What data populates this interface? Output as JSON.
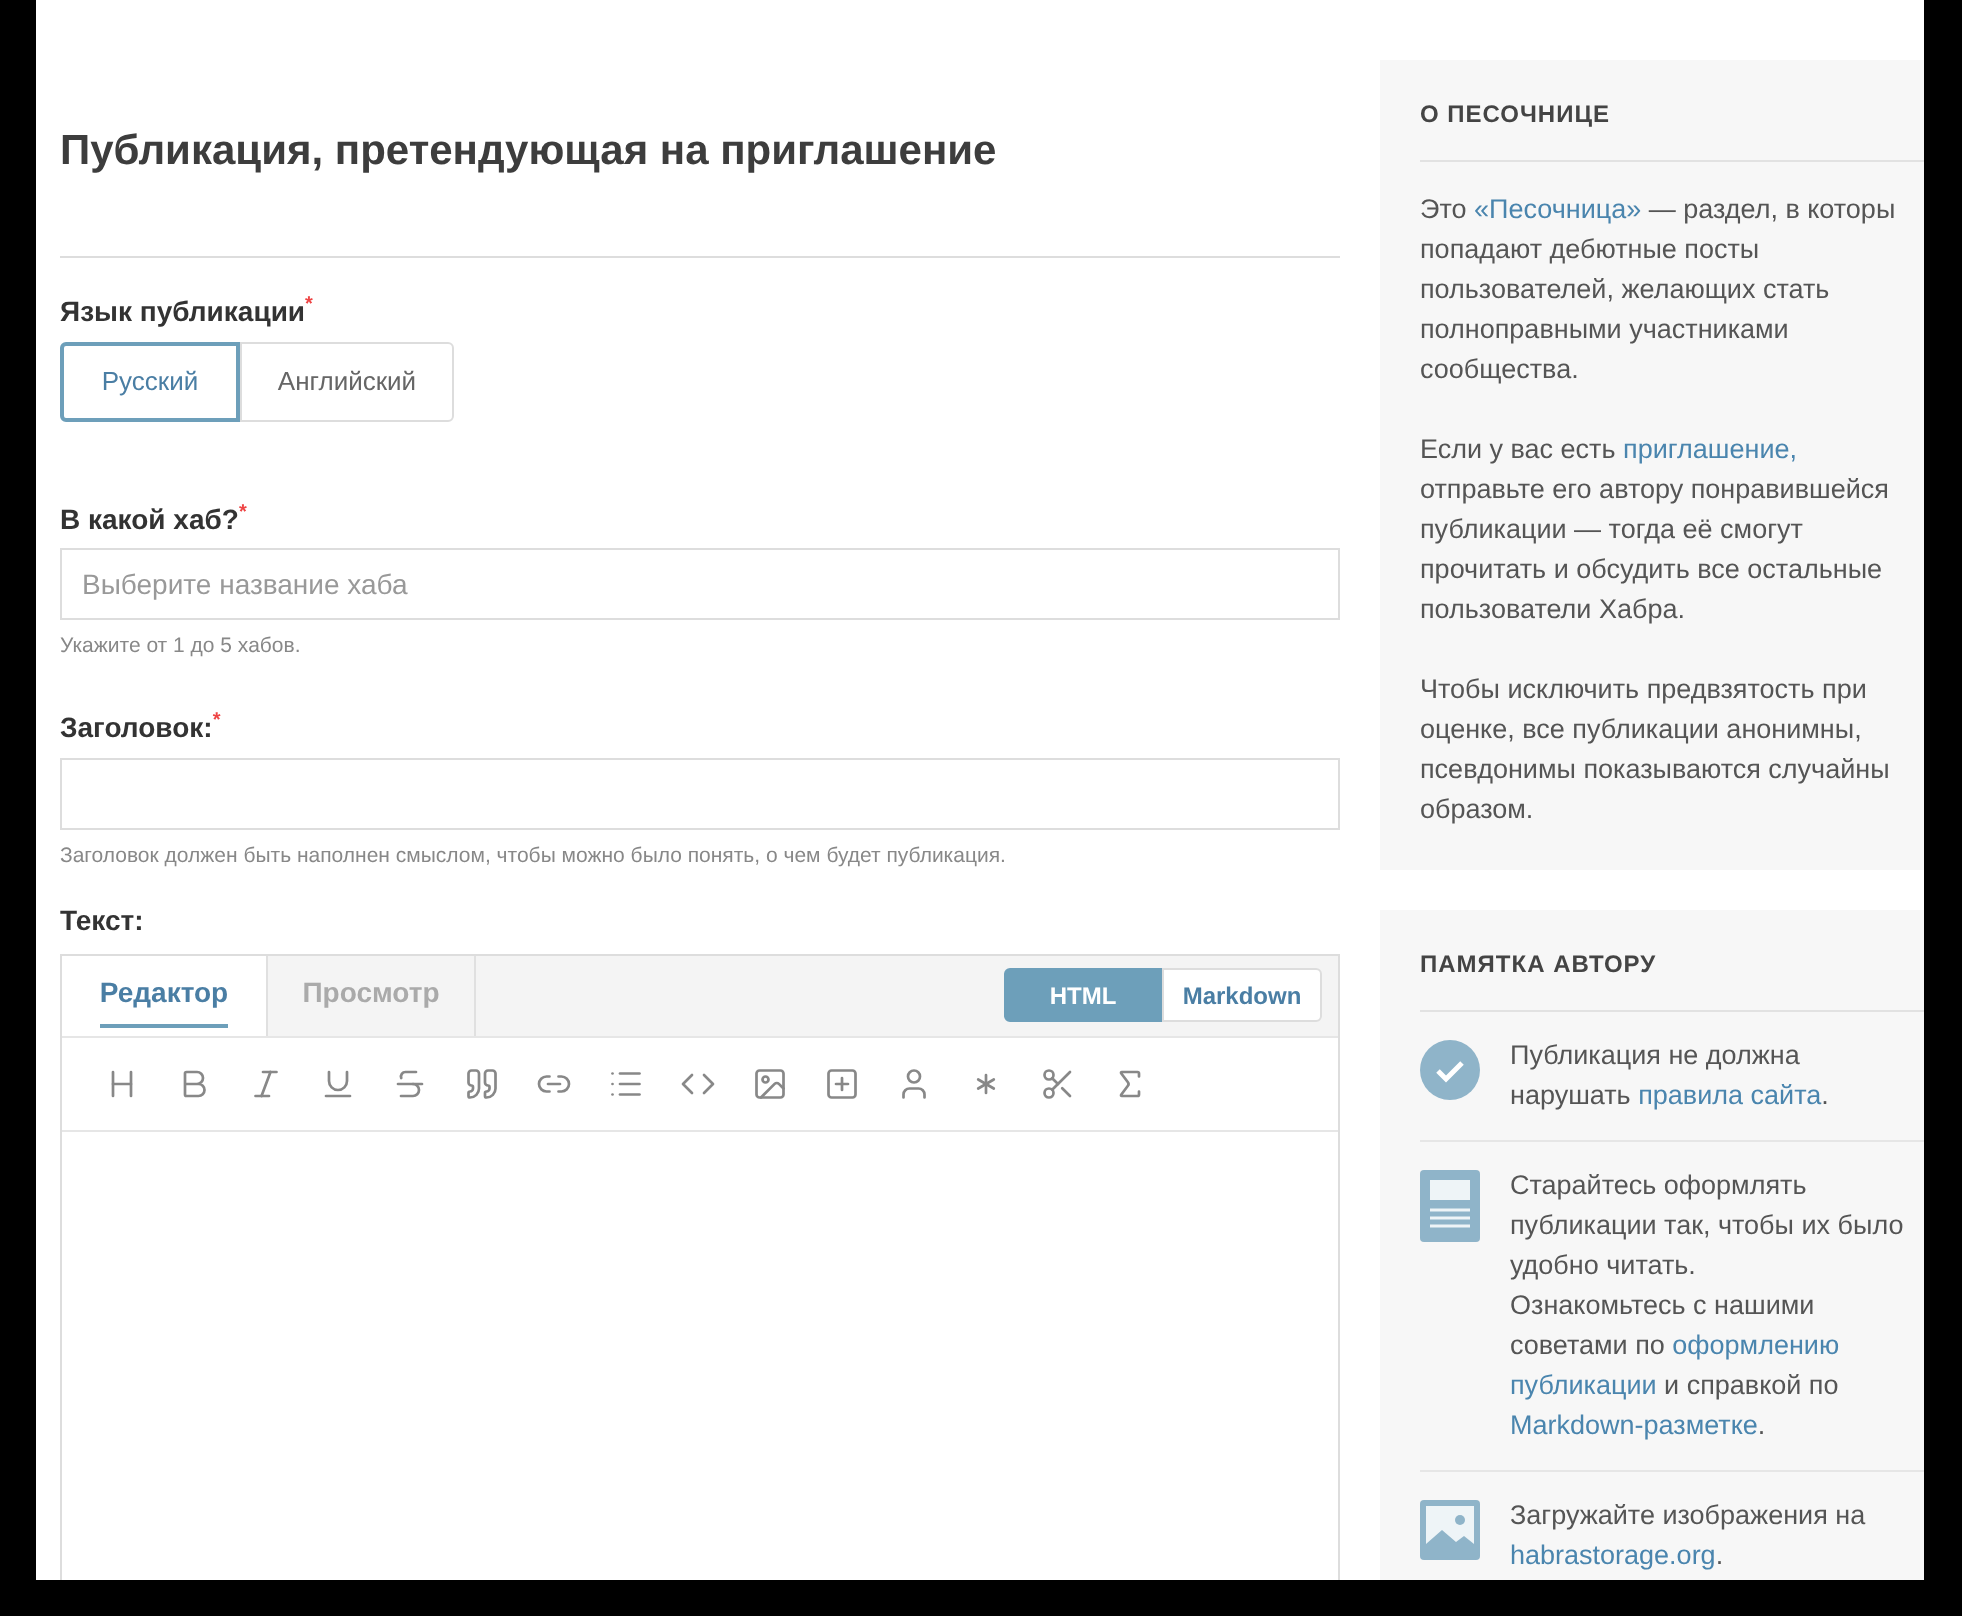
{
  "page_title": "Публикация, претендующая на приглашение",
  "language": {
    "label": "Язык публикации",
    "mark": "*",
    "options": [
      {
        "label": "Русский",
        "selected": true
      },
      {
        "label": "Английский",
        "selected": false
      }
    ]
  },
  "hub": {
    "label": "В какой хаб?",
    "mark": "*",
    "placeholder": "Выберите название хаба",
    "hint": "Укажите от 1 до 5 хабов."
  },
  "heading": {
    "label": "Заголовок:",
    "mark": "*",
    "hint": "Заголовок должен быть наполнен смыслом, чтобы можно было понять, о чем будет публикация."
  },
  "text": {
    "label": "Текст:",
    "tabs": [
      {
        "label": "Редактор",
        "selected": true
      },
      {
        "label": "Просмотр",
        "selected": false
      }
    ],
    "formats": [
      {
        "label": "HTML",
        "selected": true
      },
      {
        "label": "Markdown",
        "selected": false
      }
    ]
  },
  "sandbox": {
    "title": "О ПЕСОЧНИЦЕ",
    "paragraphs": [
      [
        {
          "kind": "text",
          "text": "Это "
        },
        {
          "kind": "link",
          "text": "«Песочница»"
        },
        {
          "kind": "text",
          "text": " — раздел, в которы\nпопадают дебютные посты\nпользователей, желающих стать\nполноправными участниками\nсообщества."
        }
      ],
      [
        {
          "kind": "text",
          "text": "Если у вас есть "
        },
        {
          "kind": "link",
          "text": "приглашение,"
        },
        {
          "kind": "text",
          "text": "\nотправьте его автору понравившейся\nпубликации — тогда её смогут\nпрочитать и обсудить все остальные\nпользователи Хабра."
        }
      ],
      [
        {
          "kind": "text",
          "text": "Чтобы исключить предвзятость при\nоценке, все публикации анонимны,\nпсевдонимы показываются случайны\nобразом."
        }
      ]
    ]
  },
  "memo": {
    "title": "ПАМЯТКА АВТОРУ",
    "tips": [
      {
        "kind": "check",
        "parts": [
          {
            "kind": "text",
            "text": "Публикация не должна\nнарушать "
          },
          {
            "kind": "link",
            "text": "правила сайта"
          },
          {
            "kind": "text",
            "text": "."
          }
        ]
      },
      {
        "kind": "document",
        "parts": [
          {
            "kind": "text",
            "text": "Старайтесь оформлять\nпубликации так, чтобы их было\nудобно читать.\nОзнакомьтесь с нашими\nсоветами по "
          },
          {
            "kind": "link",
            "text": "оформлению"
          },
          {
            "kind": "break"
          },
          {
            "kind": "link",
            "text": "публикации"
          },
          {
            "kind": "text",
            "text": " и справкой по\n"
          },
          {
            "kind": "link",
            "text": "Markdown-разметке"
          },
          {
            "kind": "text",
            "text": "."
          }
        ]
      },
      {
        "kind": "image",
        "parts": [
          {
            "kind": "text",
            "text": "Загружайте изображения на\n"
          },
          {
            "kind": "link",
            "text": "habrastorage.org"
          },
          {
            "kind": "text",
            "text": "."
          }
        ]
      }
    ]
  }
}
